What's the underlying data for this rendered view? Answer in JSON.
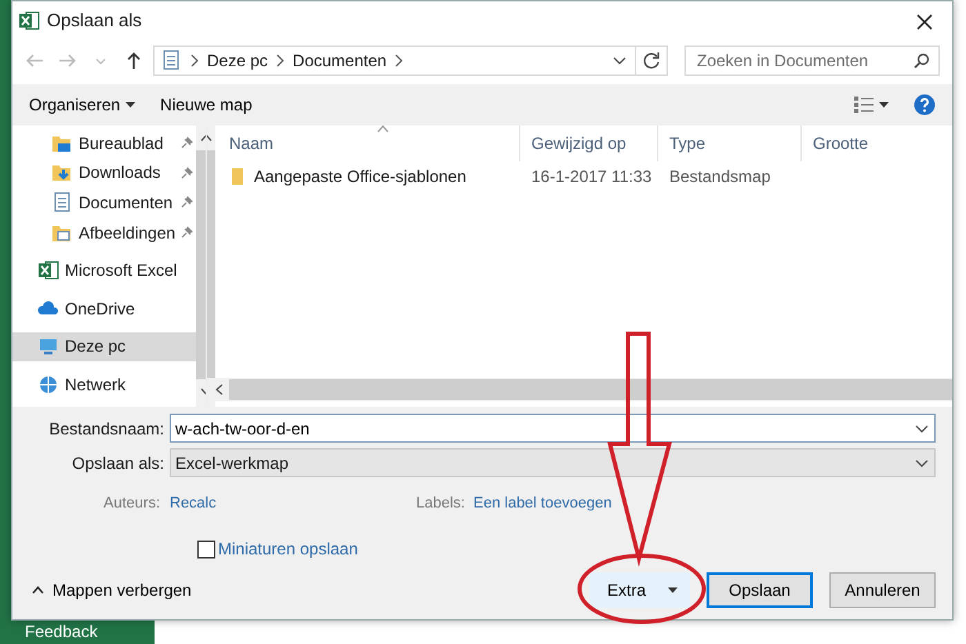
{
  "window": {
    "title": "Opslaan als"
  },
  "address_bar": {
    "path": [
      "Deze pc",
      "Documenten"
    ]
  },
  "search": {
    "placeholder": "Zoeken in Documenten"
  },
  "toolbar": {
    "organize": "Organiseren",
    "new_folder": "Nieuwe map"
  },
  "sidebar": {
    "items": [
      {
        "label": "Bureaublad",
        "kind": "desktop",
        "pinned": true,
        "selected": false
      },
      {
        "label": "Downloads",
        "kind": "downloads",
        "pinned": true,
        "selected": false
      },
      {
        "label": "Documenten",
        "kind": "documents",
        "pinned": true,
        "selected": false
      },
      {
        "label": "Afbeeldingen",
        "kind": "pictures",
        "pinned": true,
        "selected": false
      },
      {
        "label": "Microsoft Excel",
        "kind": "excel",
        "pinned": false,
        "selected": false
      },
      {
        "label": "OneDrive",
        "kind": "onedrive",
        "pinned": false,
        "selected": false
      },
      {
        "label": "Deze pc",
        "kind": "pc",
        "pinned": false,
        "selected": true
      },
      {
        "label": "Netwerk",
        "kind": "network",
        "pinned": false,
        "selected": false
      }
    ]
  },
  "file_list": {
    "columns": [
      "Naam",
      "Gewijzigd op",
      "Type",
      "Grootte"
    ],
    "rows": [
      {
        "name": "Aangepaste Office-sjablonen",
        "modified": "16-1-2017 11:33",
        "type": "Bestandsmap"
      }
    ]
  },
  "form": {
    "file_name": {
      "label": "Bestandsnaam:",
      "value": "w-ach-tw-oor-d-en"
    },
    "save_as": {
      "label": "Opslaan als:",
      "value": "Excel-werkmap"
    },
    "authors": {
      "label": "Auteurs:",
      "value": "Recalc"
    },
    "tags": {
      "label": "Labels:",
      "value": "Een label toevoegen"
    },
    "thumbnails": {
      "label": "Miniaturen opslaan",
      "checked": false
    }
  },
  "hide_folders": "Mappen verbergen",
  "buttons": [
    {
      "label": "Extra",
      "kind": "menu"
    },
    {
      "label": "Opslaan",
      "kind": "primary"
    },
    {
      "label": "Annuleren",
      "kind": "default"
    }
  ],
  "background": {
    "feedback": "Feedback"
  }
}
